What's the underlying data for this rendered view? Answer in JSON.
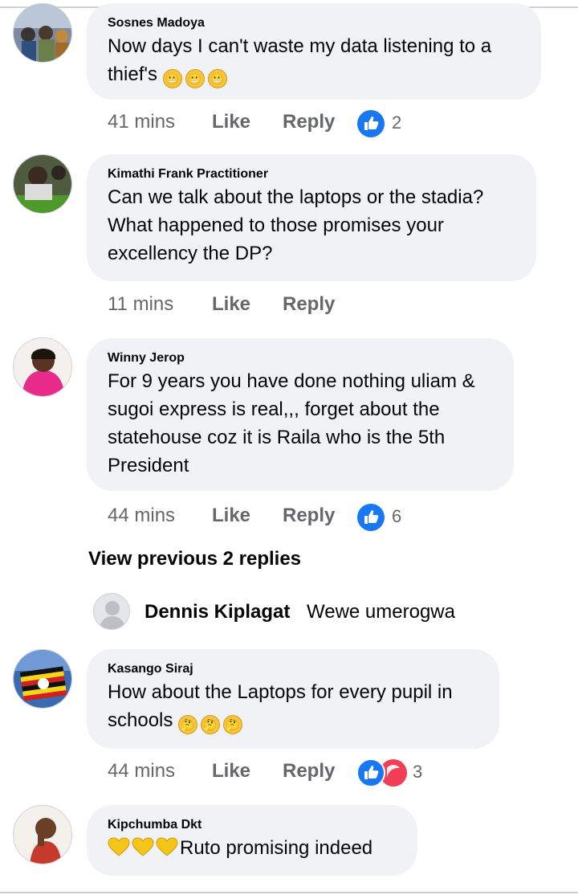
{
  "comments": [
    {
      "author": "Sosnes Madoya",
      "text": "Now days I can't waste my data listening to a thief's",
      "emoji": [
        "grimace-emoji",
        "grimace-emoji",
        "grimace-emoji"
      ],
      "time": "41 mins",
      "like_label": "Like",
      "reply_label": "Reply",
      "reactions": [
        "like-reaction-icon"
      ],
      "reaction_count": "2"
    },
    {
      "author": "Kimathi Frank Practitioner",
      "text": "Can we talk about the laptops or the stadia? What happened to those promises your excellency the DP?",
      "time": "11 mins",
      "like_label": "Like",
      "reply_label": "Reply"
    },
    {
      "author": "Winny Jerop",
      "text": "For 9 years you have done nothing uliam & sugoi express is real,,, forget about the statehouse coz it is Raila who is the 5th President",
      "time": "44 mins",
      "like_label": "Like",
      "reply_label": "Reply",
      "reactions": [
        "like-reaction-icon"
      ],
      "reaction_count": "6"
    },
    {
      "author": "Kasango Siraj",
      "text": "How about the Laptops for every pupil in schools",
      "emoji": [
        "thinking-emoji",
        "thinking-emoji",
        "thinking-emoji"
      ],
      "time": "44 mins",
      "like_label": "Like",
      "reply_label": "Reply",
      "reactions": [
        "like-reaction-icon",
        "haha-reaction-icon"
      ],
      "reaction_count": "3"
    },
    {
      "author": "Kipchumba Dkt",
      "text": "Ruto promising indeed",
      "emoji": [
        "yellow-heart-emoji",
        "yellow-heart-emoji",
        "yellow-heart-emoji"
      ]
    }
  ],
  "view_previous": "View previous 2 replies",
  "inline_reply": {
    "author": "Dennis Kiplagat",
    "text": "Wewe umerogwa"
  },
  "colors": {
    "bubble": "#f0f2f5",
    "like_blue": "#1877f2",
    "haha_red": "#f33e58",
    "meta_gray": "#65676b"
  }
}
